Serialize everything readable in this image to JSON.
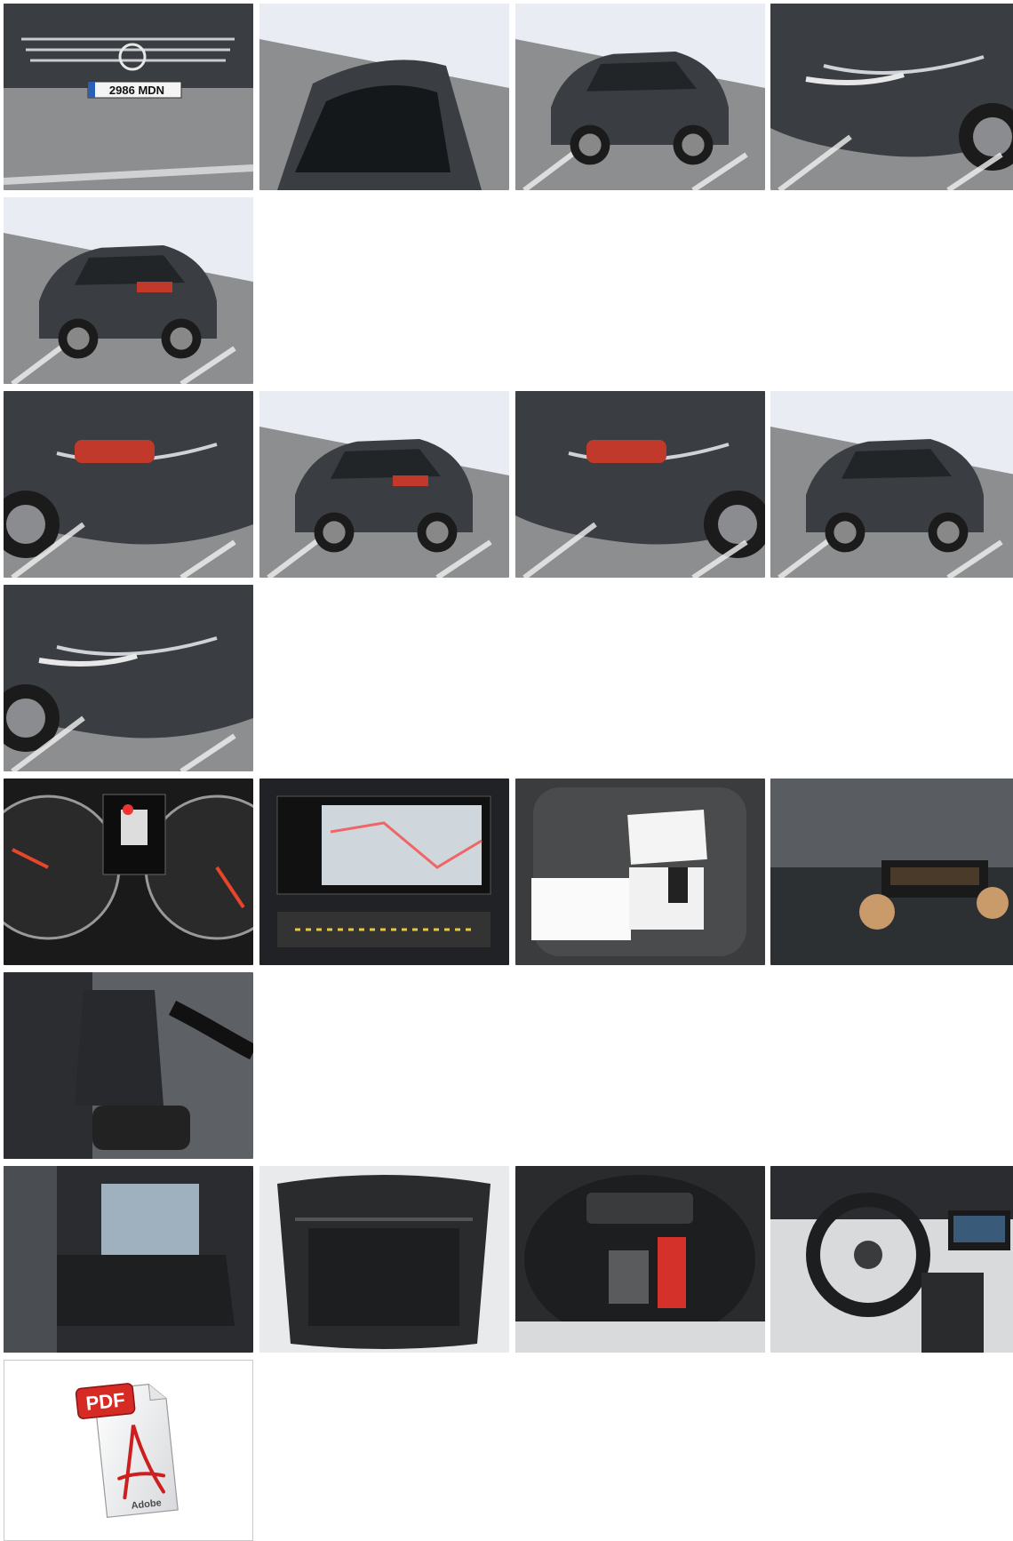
{
  "gallery": {
    "photos": [
      {
        "scene": "front-plate",
        "plate": "2986 MDN"
      },
      {
        "scene": "windshield-top"
      },
      {
        "scene": "front-3q"
      },
      {
        "scene": "front-right"
      },
      {
        "scene": "rear-left-3q"
      },
      {
        "scene": "rear-left-close"
      },
      {
        "scene": "rear-3q"
      },
      {
        "scene": "rear-right-close"
      },
      {
        "scene": "front-right-3q"
      },
      {
        "scene": "front-left-close"
      },
      {
        "scene": "dashboard-cluster"
      },
      {
        "scene": "infotainment"
      },
      {
        "scene": "documents-seat"
      },
      {
        "scene": "paint-reflection"
      },
      {
        "scene": "front-seats"
      },
      {
        "scene": "rear-seats"
      },
      {
        "scene": "trunk"
      },
      {
        "scene": "spare-wheel-well"
      },
      {
        "scene": "steering-wheel"
      }
    ],
    "pdf": {
      "badge": "PDF",
      "brand": "Adobe",
      "icon": "pdf-document-icon"
    }
  },
  "colors": {
    "car": "#3a3d41",
    "asphalt": "#8c8e90",
    "wall": "#e9edf3",
    "taillight": "#c0392b"
  }
}
